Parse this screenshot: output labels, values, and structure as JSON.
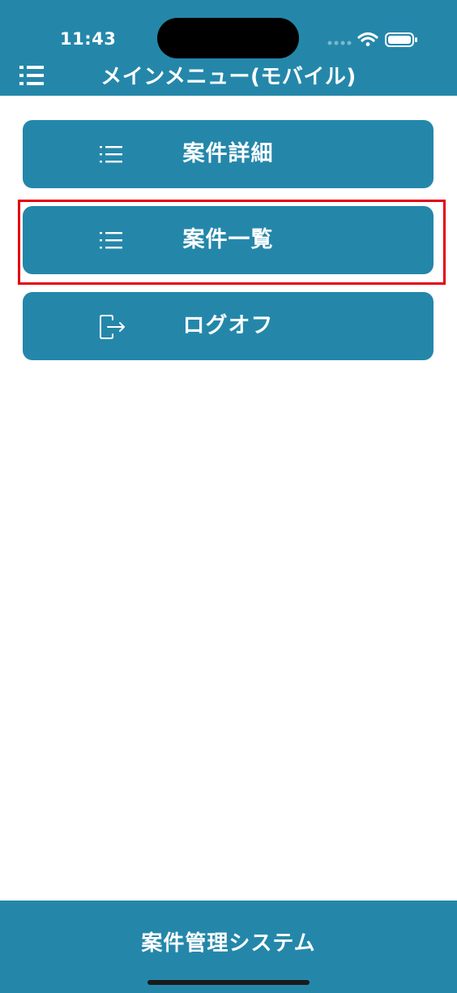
{
  "status_bar": {
    "time": "11:43"
  },
  "header": {
    "title": "メインメニュー(モバイル)",
    "menu_icon": "hamburger-list-icon"
  },
  "menu": {
    "items": [
      {
        "label": "案件詳細",
        "icon": "list-icon"
      },
      {
        "label": "案件一覧",
        "icon": "list-icon",
        "highlighted": true
      },
      {
        "label": "ログオフ",
        "icon": "logout-icon"
      }
    ]
  },
  "footer": {
    "title": "案件管理システム"
  },
  "colors": {
    "primary": "#2487aa",
    "highlight": "#e3000f",
    "text_on_primary": "#ffffff",
    "background": "#ffffff"
  }
}
